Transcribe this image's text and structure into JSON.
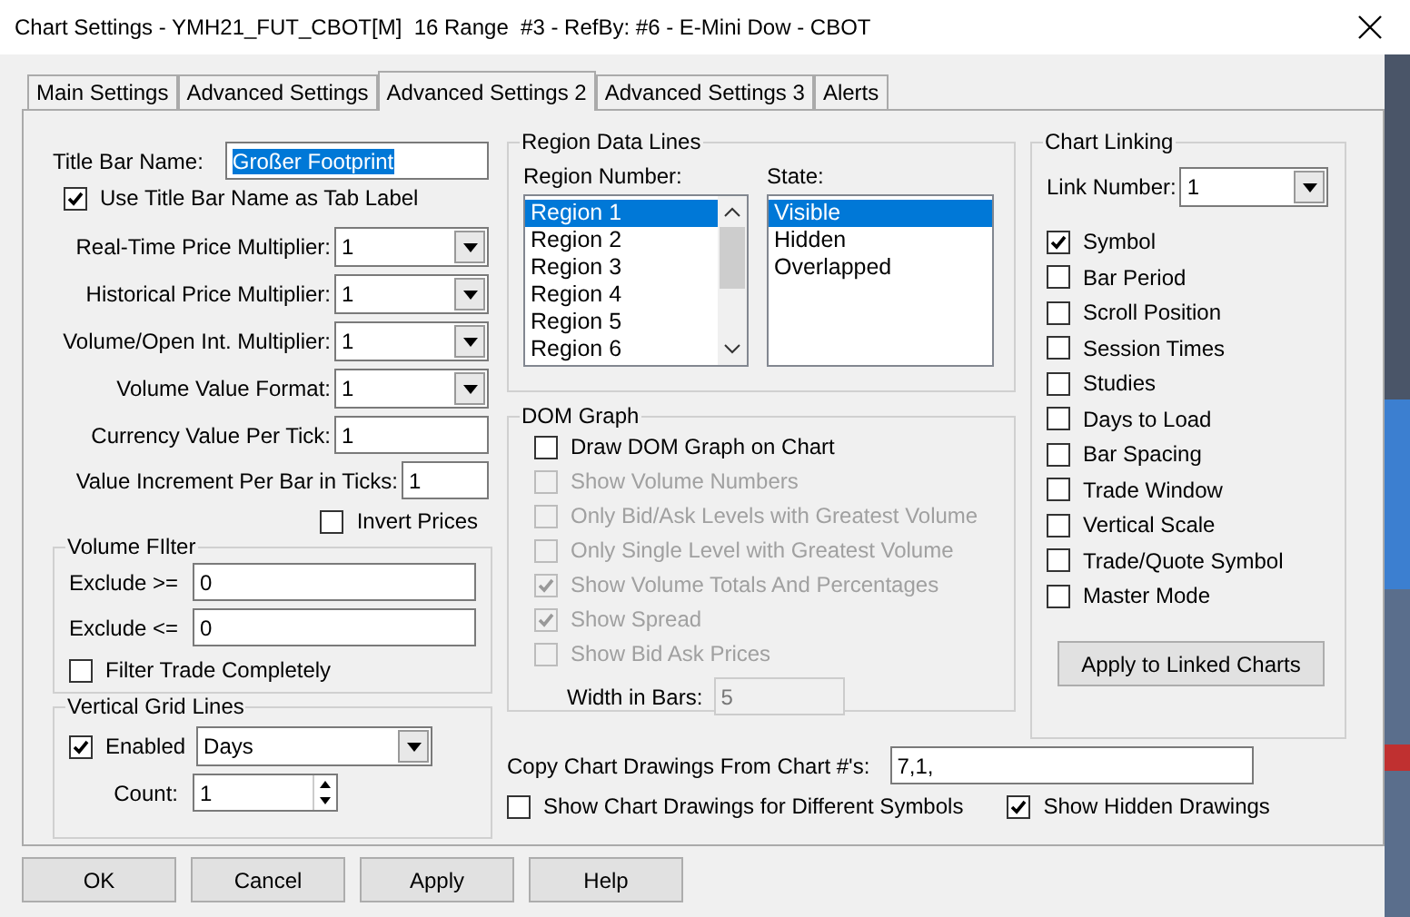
{
  "window": {
    "title": "Chart Settings - YMH21_FUT_CBOT[M]  16 Range  #3 - RefBy: #6 - E-Mini Dow - CBOT"
  },
  "tabs": [
    {
      "label": "Main Settings",
      "selected": false
    },
    {
      "label": "Advanced Settings",
      "selected": false
    },
    {
      "label": "Advanced Settings 2",
      "selected": true
    },
    {
      "label": "Advanced Settings 3",
      "selected": false
    },
    {
      "label": "Alerts",
      "selected": false
    }
  ],
  "general": {
    "title_bar_name": {
      "label": "Title Bar Name:",
      "value": "Großer Footprint",
      "selected": true
    },
    "use_title": {
      "label": "Use Title Bar Name as Tab Label",
      "checked": true
    },
    "fields": [
      {
        "label": "Real-Time Price Multiplier:",
        "value": "1",
        "kind": "dropdown"
      },
      {
        "label": "Historical Price Multiplier:",
        "value": "1",
        "kind": "dropdown"
      },
      {
        "label": "Volume/Open Int. Multiplier:",
        "value": "1",
        "kind": "dropdown"
      },
      {
        "label": "Volume Value Format:",
        "value": "1",
        "kind": "dropdown"
      },
      {
        "label": "Currency Value Per Tick:",
        "value": "1",
        "kind": "text"
      },
      {
        "label": "Value Increment Per Bar in Ticks:",
        "value": "1",
        "kind": "text"
      }
    ],
    "invert_prices": {
      "label": "Invert Prices",
      "checked": false
    }
  },
  "volume_filter": {
    "title": "Volume FIlter",
    "fields": [
      {
        "label": "Exclude >=",
        "value": "0"
      },
      {
        "label": "Exclude <=",
        "value": "0"
      }
    ],
    "filter_trade": {
      "label": "Filter Trade Completely",
      "checked": false
    }
  },
  "vertical_grid_lines": {
    "title": "Vertical Grid Lines",
    "enabled": {
      "label": "Enabled",
      "checked": true
    },
    "mode": "Days",
    "count": {
      "label": "Count:",
      "value": "1"
    }
  },
  "region_data_lines": {
    "title": "Region Data Lines",
    "region_label": "Region Number:",
    "regions": [
      {
        "label": "Region 1",
        "selected": true
      },
      {
        "label": "Region 2",
        "selected": false
      },
      {
        "label": "Region 3",
        "selected": false
      },
      {
        "label": "Region 4",
        "selected": false
      },
      {
        "label": "Region 5",
        "selected": false
      },
      {
        "label": "Region 6",
        "selected": false
      }
    ],
    "state_label": "State:",
    "states": [
      {
        "label": "Visible",
        "selected": true
      },
      {
        "label": "Hidden",
        "selected": false
      },
      {
        "label": "Overlapped",
        "selected": false
      }
    ]
  },
  "dom_graph": {
    "title": "DOM Graph",
    "options": [
      {
        "label": "Draw DOM Graph on Chart",
        "checked": false,
        "disabled": false
      },
      {
        "label": "Show Volume Numbers",
        "checked": false,
        "disabled": true
      },
      {
        "label": "Only Bid/Ask Levels with Greatest Volume",
        "checked": false,
        "disabled": true
      },
      {
        "label": "Only Single Level with Greatest Volume",
        "checked": false,
        "disabled": true
      },
      {
        "label": "Show Volume Totals And Percentages",
        "checked": true,
        "disabled": true
      },
      {
        "label": "Show Spread",
        "checked": true,
        "disabled": true
      },
      {
        "label": "Show Bid  Ask Prices",
        "checked": false,
        "disabled": true
      }
    ],
    "width": {
      "label": "Width in Bars:",
      "value": "5",
      "disabled": true
    }
  },
  "chart_linking": {
    "title": "Chart Linking",
    "link_number": {
      "label": "Link Number:",
      "value": "1"
    },
    "options": [
      {
        "label": "Symbol",
        "checked": true
      },
      {
        "label": "Bar Period",
        "checked": false
      },
      {
        "label": "Scroll Position",
        "checked": false
      },
      {
        "label": "Session Times",
        "checked": false
      },
      {
        "label": "Studies",
        "checked": false
      },
      {
        "label": "Days to Load",
        "checked": false
      },
      {
        "label": "Bar Spacing",
        "checked": false
      },
      {
        "label": "Trade Window",
        "checked": false
      },
      {
        "label": "Vertical Scale",
        "checked": false
      },
      {
        "label": "Trade/Quote Symbol",
        "checked": false
      },
      {
        "label": "Master Mode",
        "checked": false
      }
    ],
    "apply_button": "Apply to Linked Charts"
  },
  "copy_drawings": {
    "label": "Copy Chart Drawings From Chart #'s:",
    "value": "7,1,"
  },
  "bottom_options": [
    {
      "label": "Show Chart Drawings for Different Symbols",
      "checked": false
    },
    {
      "label": "Show Hidden Drawings",
      "checked": true
    }
  ],
  "buttons": [
    "OK",
    "Cancel",
    "Apply",
    "Help"
  ]
}
